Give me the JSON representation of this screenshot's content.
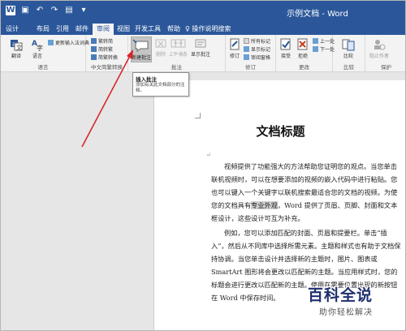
{
  "window": {
    "title": "示例文档 - Word"
  },
  "tabs": [
    {
      "label": "设计"
    },
    {
      "label": "布局"
    },
    {
      "label": "引用"
    },
    {
      "label": "邮件"
    },
    {
      "label": "审阅"
    },
    {
      "label": "视图"
    },
    {
      "label": "开发工具"
    },
    {
      "label": "帮助"
    },
    {
      "label": "操作说明搜索"
    }
  ],
  "ribbon": {
    "proofing": {
      "spelling": "翻译",
      "language": "语言",
      "update_ime": "更新输入法词典",
      "label": "语言"
    },
    "chinese": {
      "trad_to_simp": "繁转简",
      "simp_to_trad": "简转繁",
      "convert": "简繁转换",
      "label": "中文简繁转换"
    },
    "comments": {
      "new": "新建批注",
      "delete": "删除",
      "prev": "上一条",
      "next": "下一条",
      "show": "显示批注",
      "label": "批注"
    },
    "tracking": {
      "track": "修订",
      "all_markup": "所有标记",
      "show_markup": "显示标记",
      "reviewing_pane": "审阅窗格",
      "label": "修订"
    },
    "changes": {
      "accept": "接受",
      "reject": "拒绝",
      "prev": "上一处",
      "next": "下一处",
      "label": "更改"
    },
    "compare": {
      "compare": "比较",
      "label": "比较"
    },
    "protect": {
      "block": "阻止作者",
      "label": "保护"
    }
  },
  "tooltip": {
    "title": "插入批注",
    "desc": "添加有关此文档部分的注释。"
  },
  "document": {
    "heading": "文档标题",
    "p1_a": "视频提供了功能强大的方法帮助您证明您的观点。当您单击联机视频时，可以在想要添加的视频的嵌入代码中进行粘贴。您也可以键入一个关键字以联机搜索最适合您的文档的视频。为使您的文档具有",
    "p1_hl": "专业外观",
    "p1_b": "，Word 提供了页眉、页脚、封面和文本框设计，这些设计可互为补充。",
    "p2": "例如，您可以添加匹配的封面、页眉和提要栏。单击“插入”，然后从不同库中选择所需元素。主题和样式也有助于文档保持协调。当您单击设计并选择新的主题时，图片、图表或 SmartArt 图形将会更改以匹配新的主题。当应用样式时，您的标题会进行更改以匹配新的主题。使用在需要位置出现的新按钮在 Word 中保存时间。"
  },
  "watermark": {
    "big": "百科全说",
    "small": "助你轻松解决"
  },
  "colors": {
    "word_blue": "#2b579a",
    "arrow_red": "#d9262a",
    "highlight": "#d0d0d0"
  }
}
